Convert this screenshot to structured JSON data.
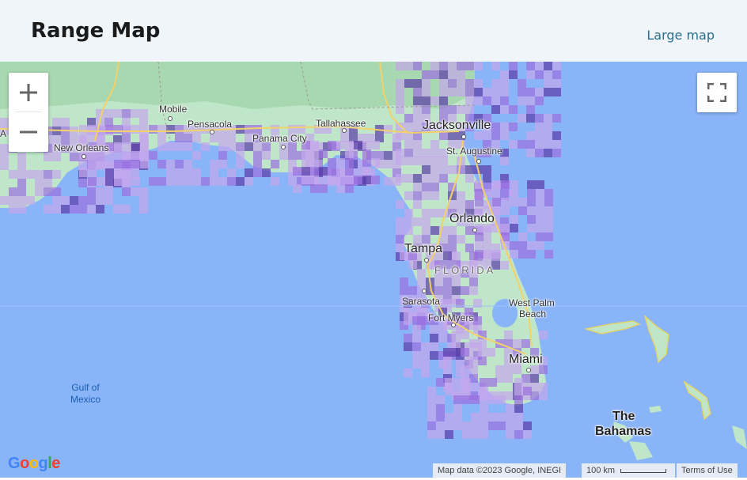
{
  "header": {
    "title": "Range Map",
    "large_map_link": "Large map"
  },
  "map": {
    "controls": {
      "zoom_in": "+",
      "zoom_out": "−"
    },
    "labels": {
      "mobile": "Mobile",
      "pensacola": "Pensacola",
      "tallahassee": "Tallahassee",
      "jacksonville": "Jacksonville",
      "st_augustine": "St. Augustine",
      "new_orleans": "New Orleans",
      "panama_city": "Panama City",
      "orlando": "Orlando",
      "tampa": "Tampa",
      "florida": "FLORIDA",
      "sarasota": "Sarasota",
      "west_palm_beach_1": "West Palm",
      "west_palm_beach_2": "Beach",
      "fort_myers": "Fort Myers",
      "miami": "Miami",
      "gulf_1": "Gulf of",
      "gulf_2": "Mexico",
      "bahamas_1": "The",
      "bahamas_2": "Bahamas",
      "edge_left": "A"
    },
    "attribution": {
      "map_data": "Map data ©2023 Google, INEGI",
      "scale": "100 km",
      "terms": "Terms of Use"
    },
    "logo_letters": [
      "G",
      "o",
      "o",
      "g",
      "l",
      "e"
    ],
    "colors": {
      "water": "#8ab4f8",
      "land": "#bfe6c8",
      "range_light": "#c4a6ec",
      "range_mid": "#9b6fe0",
      "range_dark": "#5a3aa8"
    }
  }
}
